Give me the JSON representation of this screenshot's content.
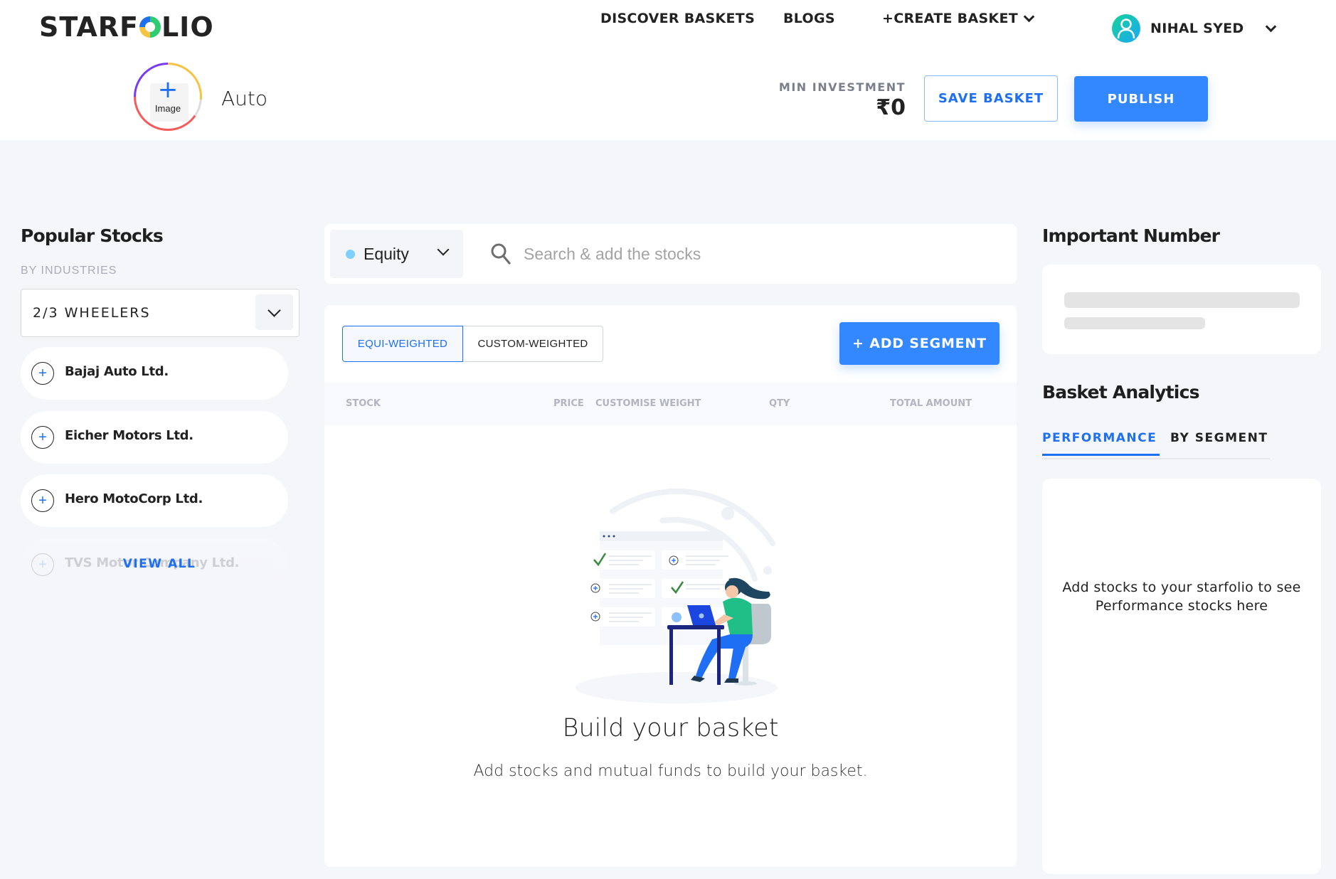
{
  "header": {
    "logo_text_before": "STARF",
    "logo_text_after": "LIO",
    "nav": {
      "discover": "DISCOVER BASKETS",
      "blogs": "BLOGS",
      "create": "+CREATE BASKET",
      "user_name": "NIHAL SYED"
    },
    "basket": {
      "image_label": "Image",
      "name": "Auto"
    },
    "min_investment": {
      "label": "MIN INVESTMENT",
      "value": "₹0"
    },
    "save_label": "SAVE BASKET",
    "publish_label": "PUBLISH"
  },
  "popular_stocks": {
    "title": "Popular Stocks",
    "subtitle": "BY INDUSTRIES",
    "industry_selected": "2/3 WHEELERS",
    "stocks": [
      {
        "name": "Bajaj Auto Ltd."
      },
      {
        "name": "Eicher Motors Ltd."
      },
      {
        "name": "Hero MotoCorp Ltd."
      },
      {
        "name": "TVS Motor Company Ltd."
      }
    ],
    "view_all_label": "VIEW ALL"
  },
  "builder": {
    "asset_type": "Equity",
    "search_placeholder": "Search & add the stocks",
    "weight_tabs": [
      {
        "label": "EQUI-WEIGHTED",
        "active": true
      },
      {
        "label": "CUSTOM-WEIGHTED",
        "active": false
      }
    ],
    "add_segment_label": "+ ADD SEGMENT",
    "columns": [
      "STOCK",
      "PRICE",
      "CUSTOMISE WEIGHT",
      "QTY",
      "TOTAL AMOUNT"
    ],
    "empty_title": "Build your basket",
    "empty_subtitle": "Add stocks and mutual funds to build your basket."
  },
  "right_panel": {
    "important_title": "Important Number",
    "analytics_title": "Basket Analytics",
    "tabs": [
      {
        "label": "PERFORMANCE",
        "active": true
      },
      {
        "label": "BY SEGMENT",
        "active": false
      }
    ],
    "analytics_empty": "Add stocks to your starfolio to see Performance stocks here"
  },
  "colors": {
    "primary": "#3388ff",
    "link": "#1e6ff2",
    "background": "#f5f6fa"
  }
}
